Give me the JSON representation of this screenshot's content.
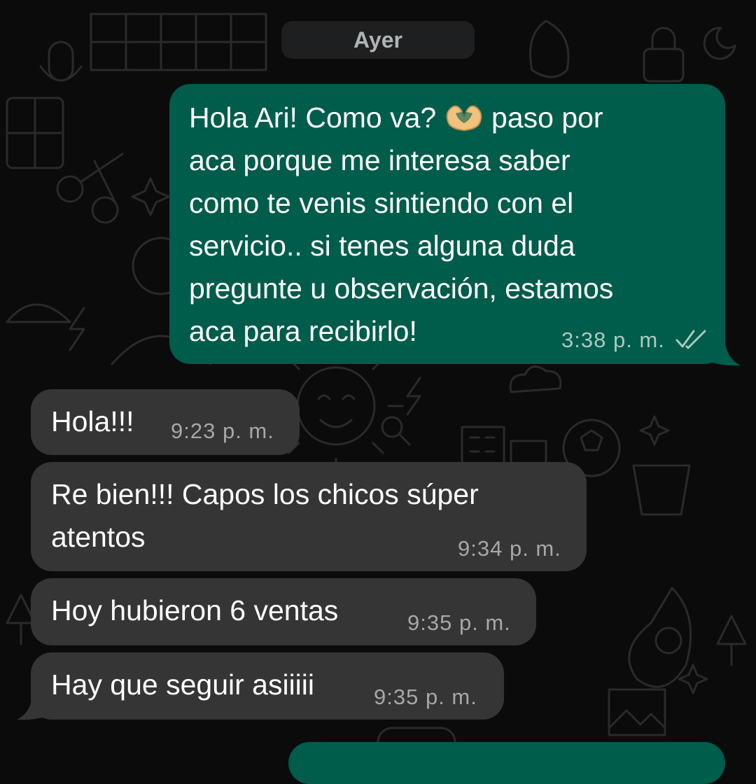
{
  "date_divider": "Ayer",
  "colors": {
    "outgoing_bubble": "#005c4b",
    "incoming_bubble": "#353535",
    "background": "#0b0b0b",
    "read_ticks": "#a9c9c1"
  },
  "messages": [
    {
      "direction": "outgoing",
      "lines": [
        "Hola Ari! Como va?",
        "paso por",
        "aca porque me interesa saber",
        "como te venis sintiendo con el",
        "servicio.. si tenes alguna duda",
        "pregunte u observación, estamos",
        "aca para recibirlo!"
      ],
      "emoji": "heart-hands",
      "time": "3:38 p. m.",
      "status_icon": "double-check-read-icon"
    },
    {
      "direction": "incoming",
      "lines": [
        "Hola!!!"
      ],
      "time": "9:23 p. m."
    },
    {
      "direction": "incoming",
      "lines": [
        "Re bien!!! Capos los chicos súper",
        "atentos"
      ],
      "time": "9:34 p. m."
    },
    {
      "direction": "incoming",
      "lines": [
        "Hoy hubieron 6 ventas"
      ],
      "time": "9:35 p. m."
    },
    {
      "direction": "incoming",
      "lines": [
        "Hay que seguir asiiiii"
      ],
      "time": "9:35 p. m."
    }
  ]
}
